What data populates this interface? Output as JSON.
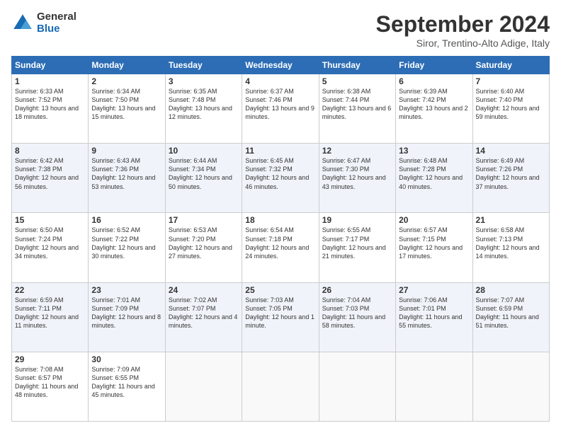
{
  "header": {
    "logo_general": "General",
    "logo_blue": "Blue",
    "title": "September 2024",
    "location": "Siror, Trentino-Alto Adige, Italy"
  },
  "days_of_week": [
    "Sunday",
    "Monday",
    "Tuesday",
    "Wednesday",
    "Thursday",
    "Friday",
    "Saturday"
  ],
  "weeks": [
    [
      {
        "day": "1",
        "info": "Sunrise: 6:33 AM\nSunset: 7:52 PM\nDaylight: 13 hours and 18 minutes."
      },
      {
        "day": "2",
        "info": "Sunrise: 6:34 AM\nSunset: 7:50 PM\nDaylight: 13 hours and 15 minutes."
      },
      {
        "day": "3",
        "info": "Sunrise: 6:35 AM\nSunset: 7:48 PM\nDaylight: 13 hours and 12 minutes."
      },
      {
        "day": "4",
        "info": "Sunrise: 6:37 AM\nSunset: 7:46 PM\nDaylight: 13 hours and 9 minutes."
      },
      {
        "day": "5",
        "info": "Sunrise: 6:38 AM\nSunset: 7:44 PM\nDaylight: 13 hours and 6 minutes."
      },
      {
        "day": "6",
        "info": "Sunrise: 6:39 AM\nSunset: 7:42 PM\nDaylight: 13 hours and 2 minutes."
      },
      {
        "day": "7",
        "info": "Sunrise: 6:40 AM\nSunset: 7:40 PM\nDaylight: 12 hours and 59 minutes."
      }
    ],
    [
      {
        "day": "8",
        "info": "Sunrise: 6:42 AM\nSunset: 7:38 PM\nDaylight: 12 hours and 56 minutes."
      },
      {
        "day": "9",
        "info": "Sunrise: 6:43 AM\nSunset: 7:36 PM\nDaylight: 12 hours and 53 minutes."
      },
      {
        "day": "10",
        "info": "Sunrise: 6:44 AM\nSunset: 7:34 PM\nDaylight: 12 hours and 50 minutes."
      },
      {
        "day": "11",
        "info": "Sunrise: 6:45 AM\nSunset: 7:32 PM\nDaylight: 12 hours and 46 minutes."
      },
      {
        "day": "12",
        "info": "Sunrise: 6:47 AM\nSunset: 7:30 PM\nDaylight: 12 hours and 43 minutes."
      },
      {
        "day": "13",
        "info": "Sunrise: 6:48 AM\nSunset: 7:28 PM\nDaylight: 12 hours and 40 minutes."
      },
      {
        "day": "14",
        "info": "Sunrise: 6:49 AM\nSunset: 7:26 PM\nDaylight: 12 hours and 37 minutes."
      }
    ],
    [
      {
        "day": "15",
        "info": "Sunrise: 6:50 AM\nSunset: 7:24 PM\nDaylight: 12 hours and 34 minutes."
      },
      {
        "day": "16",
        "info": "Sunrise: 6:52 AM\nSunset: 7:22 PM\nDaylight: 12 hours and 30 minutes."
      },
      {
        "day": "17",
        "info": "Sunrise: 6:53 AM\nSunset: 7:20 PM\nDaylight: 12 hours and 27 minutes."
      },
      {
        "day": "18",
        "info": "Sunrise: 6:54 AM\nSunset: 7:18 PM\nDaylight: 12 hours and 24 minutes."
      },
      {
        "day": "19",
        "info": "Sunrise: 6:55 AM\nSunset: 7:17 PM\nDaylight: 12 hours and 21 minutes."
      },
      {
        "day": "20",
        "info": "Sunrise: 6:57 AM\nSunset: 7:15 PM\nDaylight: 12 hours and 17 minutes."
      },
      {
        "day": "21",
        "info": "Sunrise: 6:58 AM\nSunset: 7:13 PM\nDaylight: 12 hours and 14 minutes."
      }
    ],
    [
      {
        "day": "22",
        "info": "Sunrise: 6:59 AM\nSunset: 7:11 PM\nDaylight: 12 hours and 11 minutes."
      },
      {
        "day": "23",
        "info": "Sunrise: 7:01 AM\nSunset: 7:09 PM\nDaylight: 12 hours and 8 minutes."
      },
      {
        "day": "24",
        "info": "Sunrise: 7:02 AM\nSunset: 7:07 PM\nDaylight: 12 hours and 4 minutes."
      },
      {
        "day": "25",
        "info": "Sunrise: 7:03 AM\nSunset: 7:05 PM\nDaylight: 12 hours and 1 minute."
      },
      {
        "day": "26",
        "info": "Sunrise: 7:04 AM\nSunset: 7:03 PM\nDaylight: 11 hours and 58 minutes."
      },
      {
        "day": "27",
        "info": "Sunrise: 7:06 AM\nSunset: 7:01 PM\nDaylight: 11 hours and 55 minutes."
      },
      {
        "day": "28",
        "info": "Sunrise: 7:07 AM\nSunset: 6:59 PM\nDaylight: 11 hours and 51 minutes."
      }
    ],
    [
      {
        "day": "29",
        "info": "Sunrise: 7:08 AM\nSunset: 6:57 PM\nDaylight: 11 hours and 48 minutes."
      },
      {
        "day": "30",
        "info": "Sunrise: 7:09 AM\nSunset: 6:55 PM\nDaylight: 11 hours and 45 minutes."
      },
      {
        "day": "",
        "info": ""
      },
      {
        "day": "",
        "info": ""
      },
      {
        "day": "",
        "info": ""
      },
      {
        "day": "",
        "info": ""
      },
      {
        "day": "",
        "info": ""
      }
    ]
  ]
}
